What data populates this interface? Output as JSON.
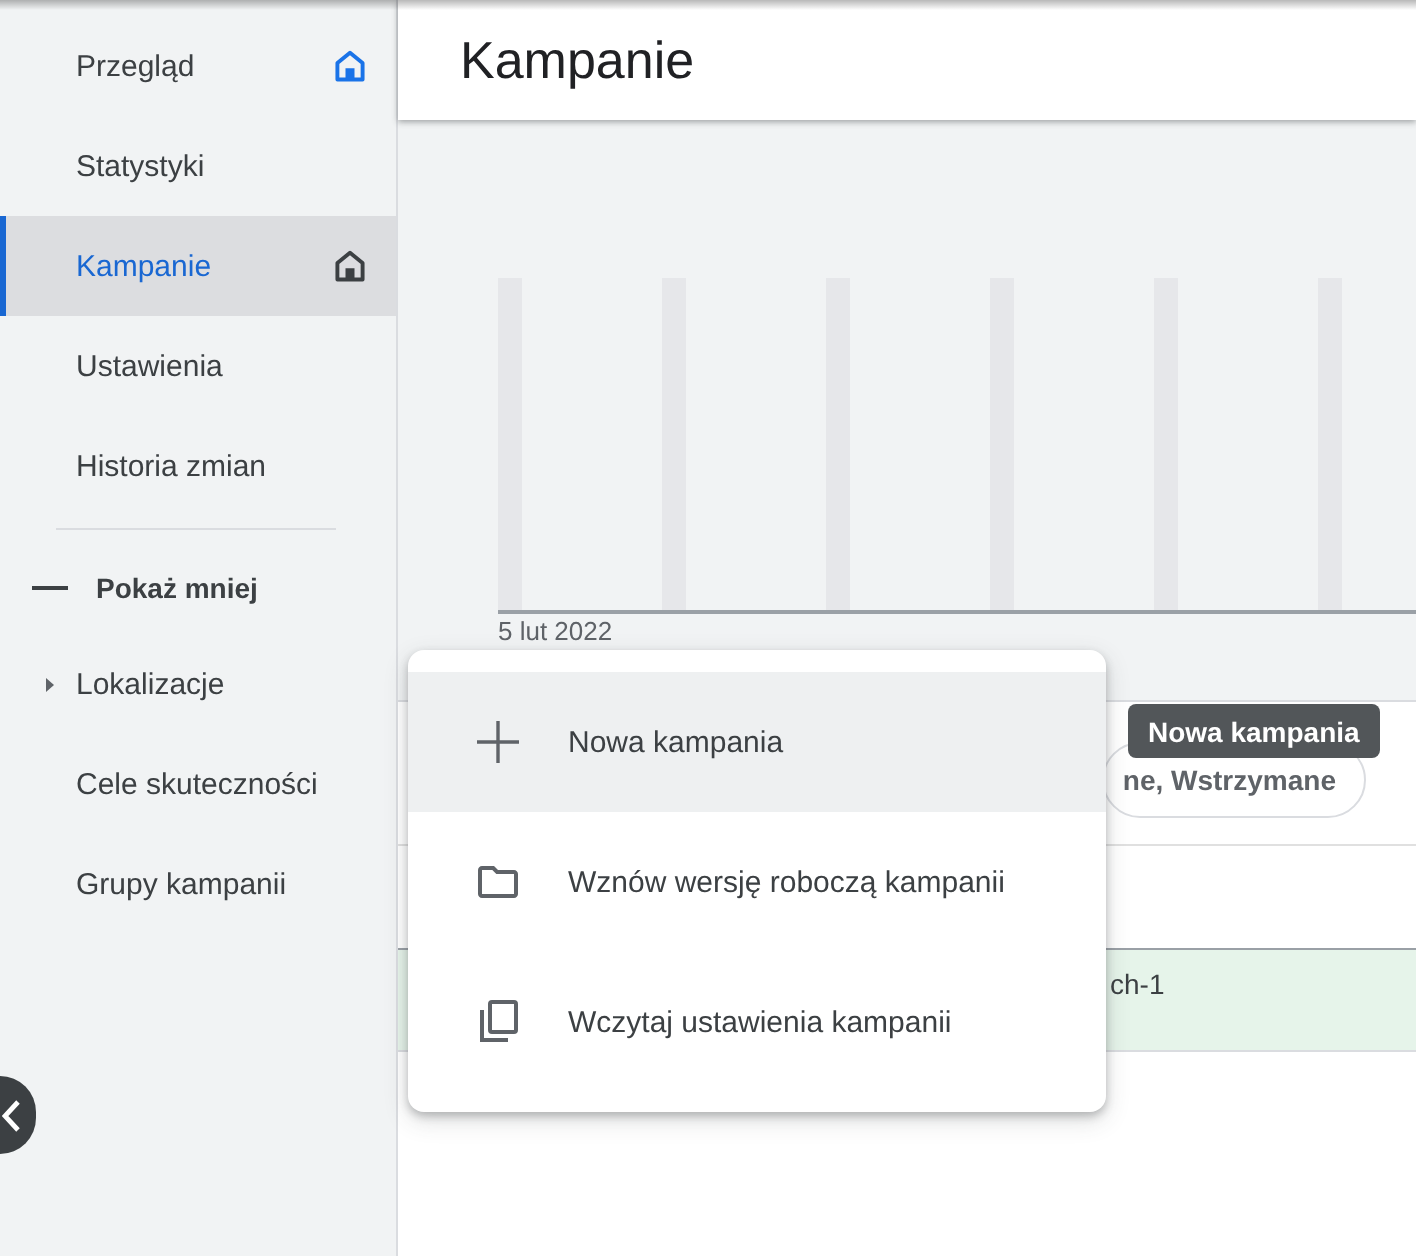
{
  "sidebar": {
    "items": [
      {
        "label": "Przegląd",
        "selected": false,
        "home_icon": true,
        "home_active": true
      },
      {
        "label": "Statystyki",
        "selected": false
      },
      {
        "label": "Kampanie",
        "selected": true,
        "home_icon": true,
        "home_active": false
      },
      {
        "label": "Ustawienia",
        "selected": false
      },
      {
        "label": "Historia zmian",
        "selected": false
      }
    ],
    "toggle": {
      "label": "Pokaż mniej",
      "expanded": true
    },
    "more_items": [
      {
        "label": "Lokalizacje",
        "kind": "group",
        "expanded": false,
        "selected": false
      },
      {
        "label": "Cele skuteczności",
        "kind": "link",
        "selected": false
      },
      {
        "label": "Grupy kampanii",
        "kind": "link",
        "selected": false
      }
    ]
  },
  "header": {
    "title": "Kampanie"
  },
  "chart": {
    "date_label": "5 lut 2022"
  },
  "filter": {
    "chip": "ne, Wstrzymane"
  },
  "table": {
    "rows": [
      {
        "cells": [
          "ch-1"
        ],
        "highlighted": true
      }
    ]
  },
  "menu": {
    "items": [
      {
        "kind": "plus",
        "label": "Nowa kampania",
        "highlighted": true
      },
      {
        "kind": "folder",
        "label": "Wznów wersję roboczą kampanii",
        "highlighted": false
      },
      {
        "kind": "copy",
        "label": "Wczytaj ustawienia kampanii",
        "highlighted": false
      }
    ]
  },
  "tooltip": {
    "text": "Nowa kampania"
  }
}
